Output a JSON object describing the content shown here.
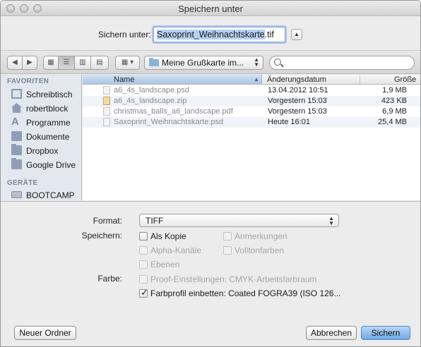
{
  "window": {
    "title": "Speichern unter"
  },
  "save_as": {
    "label": "Sichern unter:",
    "filename_selected": "Saxoprint_Weihnachtskarte",
    "filename_ext": ".tif"
  },
  "toolbar": {
    "location": "Meine Grußkarte im..."
  },
  "sidebar": {
    "favorites_header": "FAVORITEN",
    "items": [
      {
        "label": "Schreibtisch",
        "icon": "desktop-icon"
      },
      {
        "label": "robertblock",
        "icon": "home-icon"
      },
      {
        "label": "Programme",
        "icon": "applications-icon"
      },
      {
        "label": "Dokumente",
        "icon": "documents-icon"
      },
      {
        "label": "Dropbox",
        "icon": "folder-icon"
      },
      {
        "label": "Google Drive",
        "icon": "folder-icon"
      }
    ],
    "devices_header": "GERÄTE",
    "devices": [
      {
        "label": "BOOTCAMP",
        "icon": "drive-icon"
      }
    ]
  },
  "filelist": {
    "columns": {
      "name": "Name",
      "date": "Änderungsdatum",
      "size": "Größe"
    },
    "rows": [
      {
        "name": "a6_4s_landscape.psd",
        "date": "13.04.2012 10:51",
        "size": "1,9 MB",
        "icon": "psd-file-icon"
      },
      {
        "name": "a6_4s_landscape.zip",
        "date": "Vorgestern 15:03",
        "size": "423 KB",
        "icon": "zip-file-icon"
      },
      {
        "name": "christmas_balls_a6_landscape.pdf",
        "date": "Vorgestern 15:03",
        "size": "6,9 MB",
        "icon": "pdf-file-icon"
      },
      {
        "name": "Saxoprint_Weihnachtskarte.psd",
        "date": "Heute 16:01",
        "size": "25,4 MB",
        "icon": "psd-file-icon"
      }
    ]
  },
  "options": {
    "format_label": "Format:",
    "format_value": "TIFF",
    "save_label": "Speichern:",
    "as_copy": {
      "label": "Als Kopie",
      "checked": false,
      "enabled": true
    },
    "annotations": {
      "label": "Anmerkungen",
      "checked": false,
      "enabled": false
    },
    "alpha": {
      "label": "Alpha-Kanäle",
      "checked": false,
      "enabled": false
    },
    "spot": {
      "label": "Volltonfarben",
      "checked": false,
      "enabled": false
    },
    "layers": {
      "label": "Ebenen",
      "checked": false,
      "enabled": false
    },
    "color_label": "Farbe:",
    "proof": {
      "label": "Proof-Einstellungen: CMYK-Arbeitsfarbraum",
      "checked": false,
      "enabled": false
    },
    "embed": {
      "label": "Farbprofil einbetten: Coated FOGRA39 (ISO 126...",
      "checked": true,
      "enabled": true
    }
  },
  "footer": {
    "new_folder": "Neuer Ordner",
    "cancel": "Abbrechen",
    "save": "Sichern"
  },
  "colors": {
    "accent": "#6fa8e8",
    "selection": "#b5d1f3",
    "sidebar_bg": "#e3e8ee"
  }
}
